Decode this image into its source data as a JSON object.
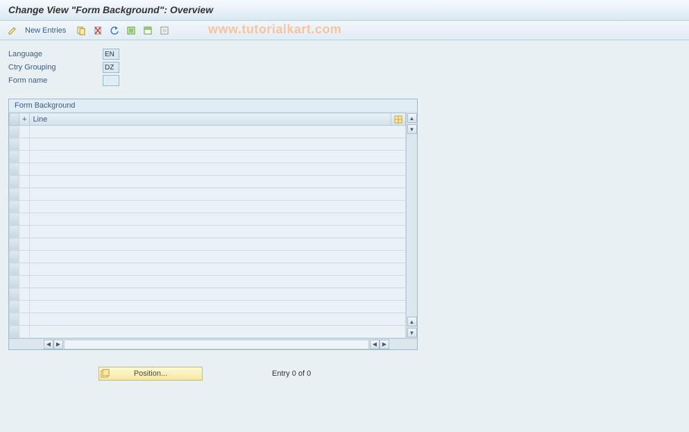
{
  "title": "Change View \"Form Background\": Overview",
  "toolbar": {
    "new_entries_label": "New Entries"
  },
  "watermark": "www.tutorialkart.com",
  "fields": {
    "language": {
      "label": "Language",
      "value": "EN"
    },
    "ctry_grouping": {
      "label": "Ctry Grouping",
      "value": "DZ"
    },
    "form_name": {
      "label": "Form name",
      "value": ""
    }
  },
  "grid": {
    "panel_title": "Form Background",
    "columns": {
      "plus": "+",
      "line": "Line"
    },
    "row_count": 17
  },
  "footer": {
    "position_label": "Position...",
    "entry_text": "Entry 0 of 0"
  }
}
